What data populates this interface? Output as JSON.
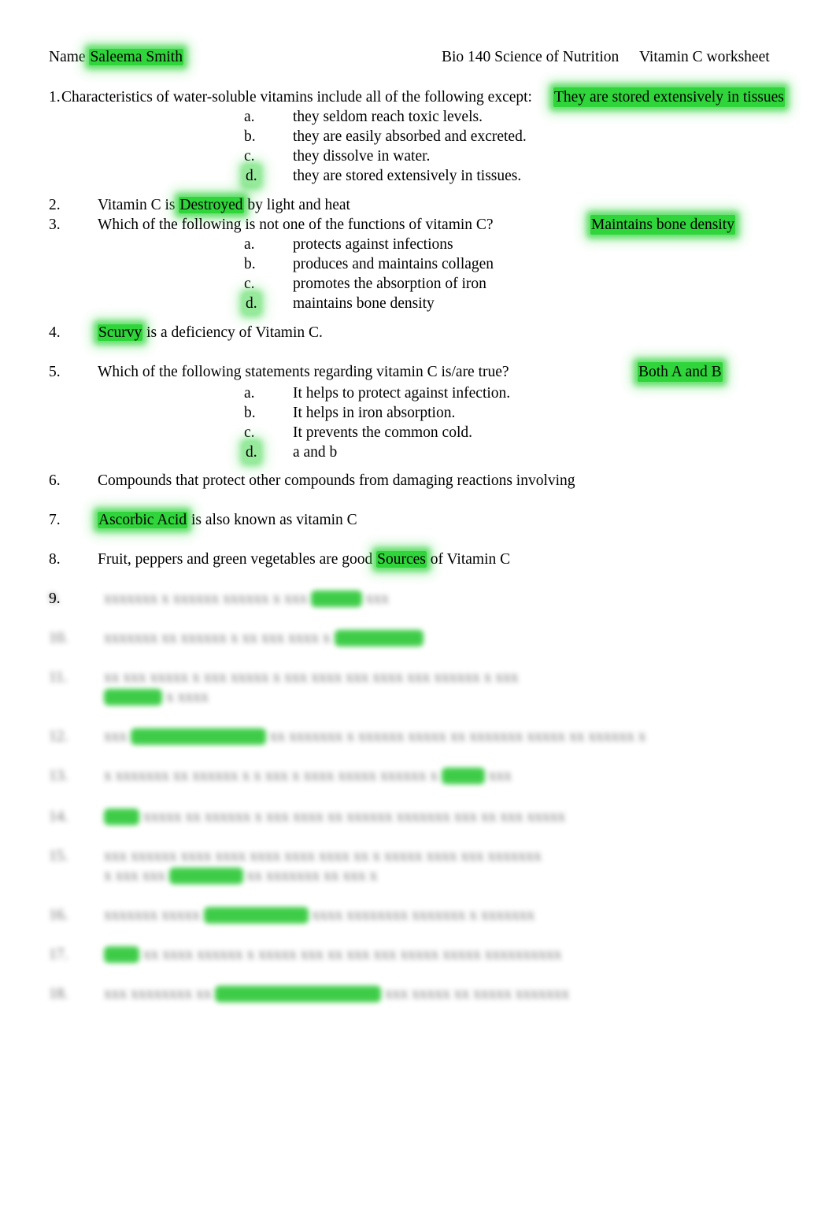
{
  "document": {
    "title": "Vitamin C worksheet",
    "highlight_color": "#2fd53a",
    "page_background": "#ffffff",
    "text_color": "#000000"
  },
  "header": {
    "name_label": "Name",
    "student_name": "Saleema Smith",
    "course": "Bio 140 Science of Nutrition",
    "worksheet": "Vitamin C worksheet"
  },
  "questions": [
    {
      "number": "1.",
      "stem": "Characteristics of water-soluble vitamins include all of the following except:",
      "answer": "They are stored extensively in tissues",
      "options": [
        {
          "letter": "a.",
          "text": "they seldom reach toxic levels."
        },
        {
          "letter": "b.",
          "text": "they are easily absorbed and excreted."
        },
        {
          "letter": "c.",
          "text": "they dissolve in water."
        },
        {
          "letter": "d.",
          "text": "they are stored extensively in tissues."
        }
      ]
    },
    {
      "number": "2.",
      "stem_before": "Vitamin C is",
      "stem_answer": "Destroyed",
      "stem_after": "by light and heat"
    },
    {
      "number": "3.",
      "stem": "Which of the following is not  one of the functions of vitamin C?",
      "answer": "Maintains bone density",
      "options": [
        {
          "letter": "a.",
          "text": "protects against infections"
        },
        {
          "letter": "b.",
          "text": "produces and maintains collagen"
        },
        {
          "letter": "c.",
          "text": "promotes the absorption of iron"
        },
        {
          "letter": "d.",
          "text": "maintains bone density"
        }
      ]
    },
    {
      "number": "4.",
      "stem_answer": "Scurvy",
      "stem_after": "is a deficiency of Vitamin C."
    },
    {
      "number": "5.",
      "stem": "Which of the following statements regarding vitamin C is/are true?",
      "answer": "Both A and B",
      "options": [
        {
          "letter": "a.",
          "text": "It helps to protect against infection."
        },
        {
          "letter": "b.",
          "text": "It helps in iron absorption."
        },
        {
          "letter": "c.",
          "text": "It prevents the common cold."
        },
        {
          "letter": "d.",
          "text": "a and b"
        }
      ]
    },
    {
      "number": "6.",
      "stem": "Compounds that protect other compounds from damaging reactions involving"
    },
    {
      "number": "7.",
      "stem_answer": "Ascorbic Acid",
      "stem_after": "is also known as vitamin C"
    },
    {
      "number": "8.",
      "stem_before": "Fruit, peppers and green vegetables are good",
      "stem_answer": "Sources",
      "stem_after": "of Vitamin C"
    }
  ],
  "redacted_section": {
    "note": "Remaining numbered items 9 through 18 are visually blurred and unreadable in the screenshot.",
    "first_visible_number": "9.",
    "rows": [
      {
        "num": "9.",
        "pre": "xxxxxxx x xxxxxx xxxxxx x xxx",
        "hl": "xxxxxx",
        "post": "xxx"
      },
      {
        "num": "10.",
        "pre": "xxxxxxx xx xxxxxx x xx xxx xxxx x",
        "hl": "xxxxxxxxxxx",
        "post": ""
      },
      {
        "num": "11.",
        "pre": "xx xxx xxxxx x xxx xxxxx x xxx xxxx xxx xxxx xxx xxxxxx x xxx",
        "hl": "",
        "post": ""
      },
      {
        "num": "11b",
        "pre": "",
        "hl": "xxxxxxx",
        "post": "x xxxx"
      },
      {
        "num": "12.",
        "pre": "xxx",
        "hl": "xxxxxxxxxxxxxxxxx",
        "post": "xx xxxxxxx x xxxxxx xxxxx xx xxxxxxx xxxxx xx xxxxxx x"
      },
      {
        "num": "13.",
        "pre": "x xxxxxxx xx xxxxxx x x xxx x xxxx xxxxx xxxxxx x",
        "hl": "xxxxx",
        "post": "xxx"
      },
      {
        "num": "14.",
        "hl": "xxxx",
        "post": "xxxxx xx xxxxxx x xxx xxxx xx xxxxxx xxxxxxx xxx xx xxx xxxxx"
      },
      {
        "num": "15.",
        "pre": "xxx xxxxxx xxxx xxxx xxxx xxxx xxxx xx x xxxxx xxxx xxx xxxxxxx",
        "hl": "",
        "post": ""
      },
      {
        "num": "15b",
        "pre": "x xxx xxx",
        "hl": "xxxxxxxxx",
        "post": "xx xxxxxxx xx xxx x"
      },
      {
        "num": "16.",
        "pre": "xxxxxxx xxxxx",
        "hl": "xxxxxxxxxxxxx",
        "post": "xxxx xxxxxxxx xxxxxxx x xxxxxxx"
      },
      {
        "num": "17.",
        "hl": "xxxx",
        "post": "xx xxxx xxxxxx x xxxxx xxx xx xxx xxx xxxxx xxxxx xxxxxxxxxx"
      },
      {
        "num": "18.",
        "pre": "xxx xxxxxxxx xx",
        "hl": "xxxxxxxxxxxxxxxxxxxxx",
        "post": "xxx xxxxx xx xxxxx xxxxxxx"
      }
    ]
  }
}
